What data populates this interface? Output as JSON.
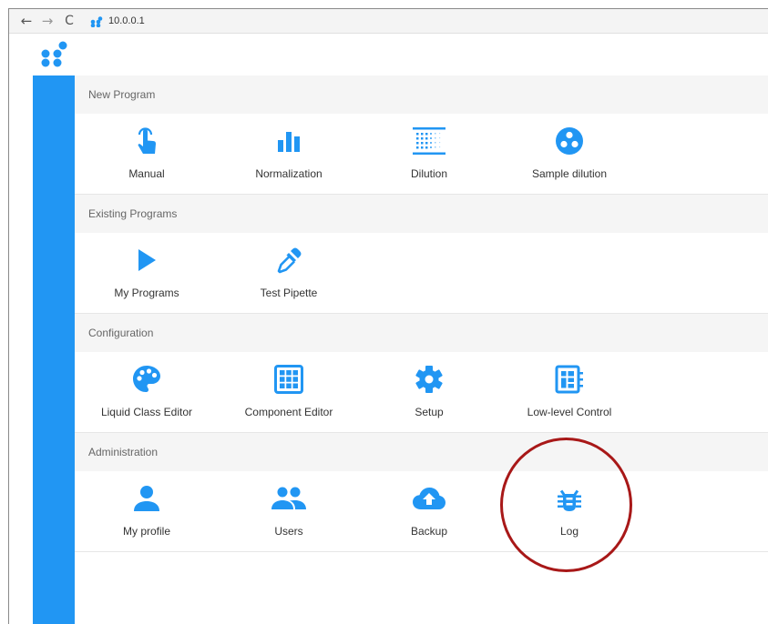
{
  "browser": {
    "back_icon": "←",
    "forward_icon": "→",
    "reload_icon": "C",
    "url": "10.0.0.1"
  },
  "colors": {
    "accent": "#2196f3",
    "highlight": "#a81818"
  },
  "sections": [
    {
      "title": "New Program",
      "tiles": [
        {
          "label": "Manual",
          "icon": "touch-app-icon"
        },
        {
          "label": "Normalization",
          "icon": "bar-chart-icon"
        },
        {
          "label": "Dilution",
          "icon": "grid-dots-icon"
        },
        {
          "label": "Sample dilution",
          "icon": "three-dots-circle-icon"
        }
      ]
    },
    {
      "title": "Existing Programs",
      "tiles": [
        {
          "label": "My Programs",
          "icon": "play-icon"
        },
        {
          "label": "Test Pipette",
          "icon": "pipette-icon"
        }
      ]
    },
    {
      "title": "Configuration",
      "tiles": [
        {
          "label": "Liquid Class Editor",
          "icon": "palette-icon"
        },
        {
          "label": "Component Editor",
          "icon": "grid-icon"
        },
        {
          "label": "Setup",
          "icon": "gear-icon"
        },
        {
          "label": "Low-level Control",
          "icon": "chip-icon"
        }
      ]
    },
    {
      "title": "Administration",
      "tiles": [
        {
          "label": "My profile",
          "icon": "person-icon"
        },
        {
          "label": "Users",
          "icon": "people-icon"
        },
        {
          "label": "Backup",
          "icon": "cloud-upload-icon"
        },
        {
          "label": "Log",
          "icon": "bug-icon"
        }
      ]
    }
  ]
}
